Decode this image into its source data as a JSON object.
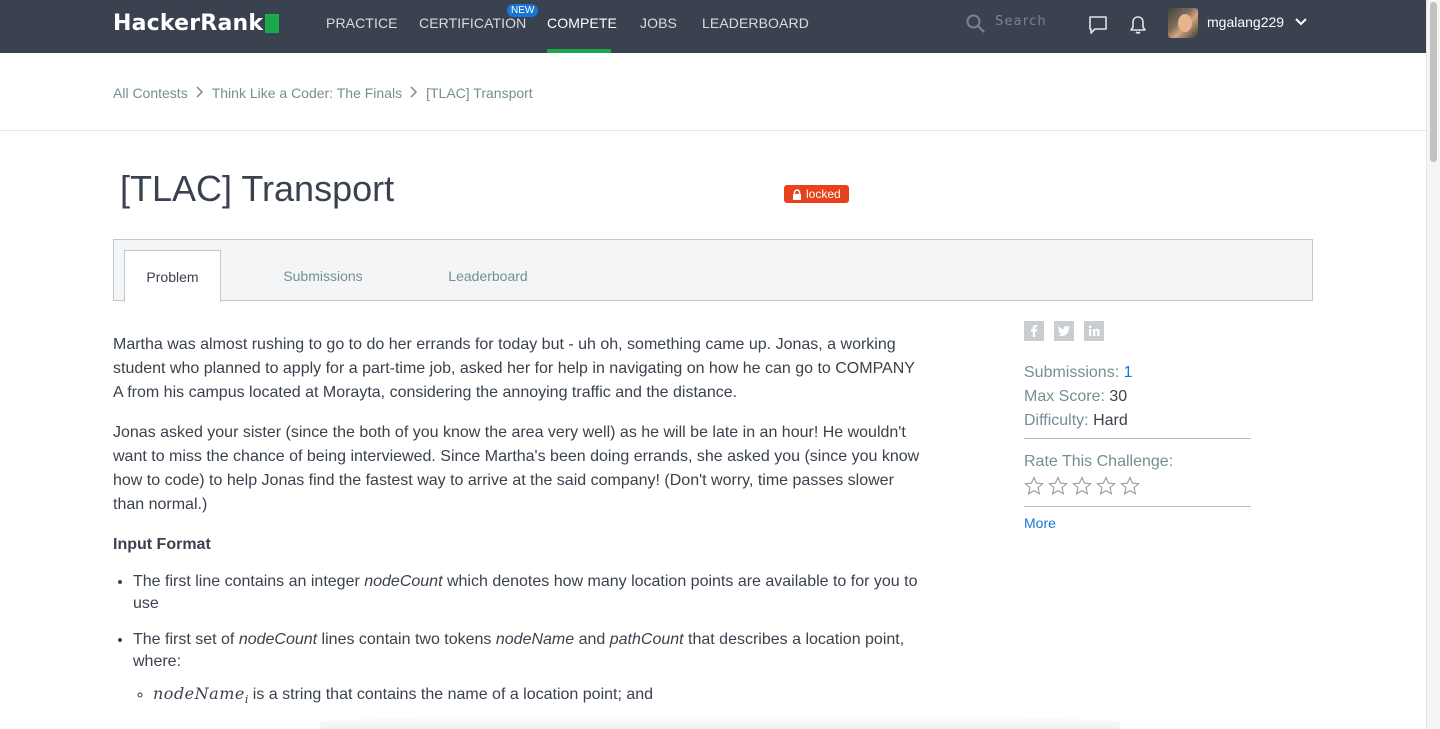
{
  "nav": {
    "logo_text": "HackerRank",
    "items": [
      {
        "label": "PRACTICE"
      },
      {
        "label": "CERTIFICATION"
      },
      {
        "label": "COMPETE"
      },
      {
        "label": "JOBS"
      },
      {
        "label": "LEADERBOARD"
      }
    ],
    "active": "COMPETE",
    "new_badge": "NEW",
    "search_placeholder": "Search",
    "username": "mgalang229"
  },
  "breadcrumb": [
    "All Contests",
    "Think Like a Coder: The Finals",
    "[TLAC] Transport"
  ],
  "challenge": {
    "title": "[TLAC] Transport",
    "status_badge": "locked"
  },
  "tabs": [
    {
      "label": "Problem"
    },
    {
      "label": "Submissions"
    },
    {
      "label": "Leaderboard"
    }
  ],
  "problem": {
    "para1": "Martha was almost rushing to go to do her errands for today but - uh oh, something came up. Jonas, a working student who planned to apply for a part-time job, asked her for help in navigating on how he can go to COMPANY A from his campus located at Morayta, considering the annoying traffic and the distance.",
    "para2": "Jonas asked your sister (since the both of you know the area very well) as he will be late in an hour! He wouldn't want to miss the chance of being interviewed. Since Martha's been doing errands, she asked you (since you know how to code) to help Jonas find the fastest way to arrive at the said company! (Don't worry, time passes slower than normal.)",
    "input_format_heading": "Input Format",
    "bullet1_pre": "The first line contains an integer ",
    "bullet1_var": "nodeCount",
    "bullet1_post": " which denotes how many location points are available to for you to use",
    "bullet2_pre": "The first set of ",
    "bullet2_var1": "nodeCount",
    "bullet2_mid1": " lines contain two tokens ",
    "bullet2_var2": "nodeName",
    "bullet2_mid2": " and ",
    "bullet2_var3": "pathCount",
    "bullet2_post": " that describes a location point, where:",
    "sub1_var": "nodeName",
    "sub1_idx": "i",
    "sub1_text": " is a string that contains the name of a location point; and"
  },
  "sidebar": {
    "share_icons": [
      "facebook-icon",
      "twitter-icon",
      "linkedin-icon"
    ],
    "submissions_label": "Submissions:",
    "submissions_value": "1",
    "max_score_label": "Max Score:",
    "max_score_value": "30",
    "difficulty_label": "Difficulty:",
    "difficulty_value": "Hard",
    "rate_label": "Rate This Challenge:",
    "stars": 0,
    "more_label": "More"
  },
  "colors": {
    "nav_bg": "#39424e",
    "accent_green": "#1ba94c",
    "locked_red": "#e8411c",
    "link_blue": "#1976d2"
  }
}
